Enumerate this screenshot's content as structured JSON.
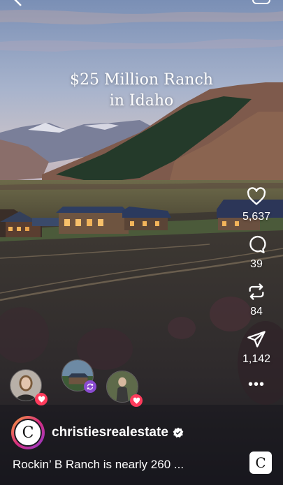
{
  "post": {
    "headline_line1": "$25 Million Ranch",
    "headline_line2": "in Idaho"
  },
  "actions": {
    "like_count": "5,637",
    "comment_count": "39",
    "repost_count": "84",
    "share_count": "1,142",
    "more_label": "•••"
  },
  "account": {
    "initial": "C",
    "username": "christiesrealestate"
  },
  "caption": "Rockin’ B Ranch is nearly 260 ...",
  "music_tile_initial": "C",
  "colors": {
    "like_badge": "#ff3b5c",
    "repost_badge": "#8a4bd0",
    "verified": "#ffffff"
  }
}
